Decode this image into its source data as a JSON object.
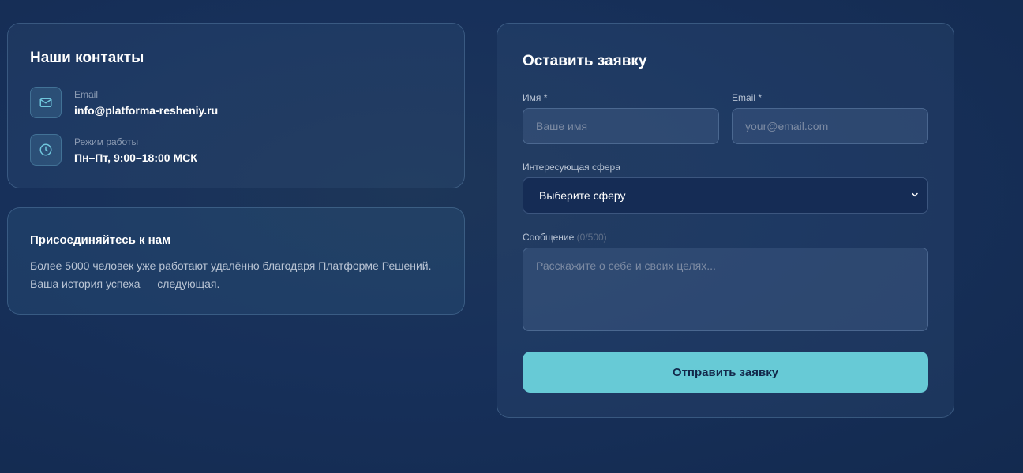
{
  "contacts": {
    "title": "Наши контакты",
    "email": {
      "icon": "mail-icon",
      "label": "Email",
      "value": "info@platforma-resheniy.ru"
    },
    "hours": {
      "icon": "clock-icon",
      "label": "Режим работы",
      "value": "Пн–Пт, 9:00–18:00 МСК"
    }
  },
  "join": {
    "title": "Присоединяйтесь к нам",
    "text": "Более 5000 человек уже работают удалённо благодаря Платформе Решений. Ваша история успеха — следующая."
  },
  "form": {
    "title": "Оставить заявку",
    "name_label": "Имя *",
    "name_placeholder": "Ваше имя",
    "email_label": "Email *",
    "email_placeholder": "your@email.com",
    "sphere_label": "Интересующая сфера",
    "sphere_value": "Выберите сферу",
    "message_label": "Сообщение",
    "message_counter": "(0/500)",
    "message_placeholder": "Расскажите о себе и своих целях...",
    "submit_label": "Отправить заявку"
  },
  "colors": {
    "background": "#16305a",
    "accent": "#67cad6",
    "icon": "#6fc6dc"
  }
}
